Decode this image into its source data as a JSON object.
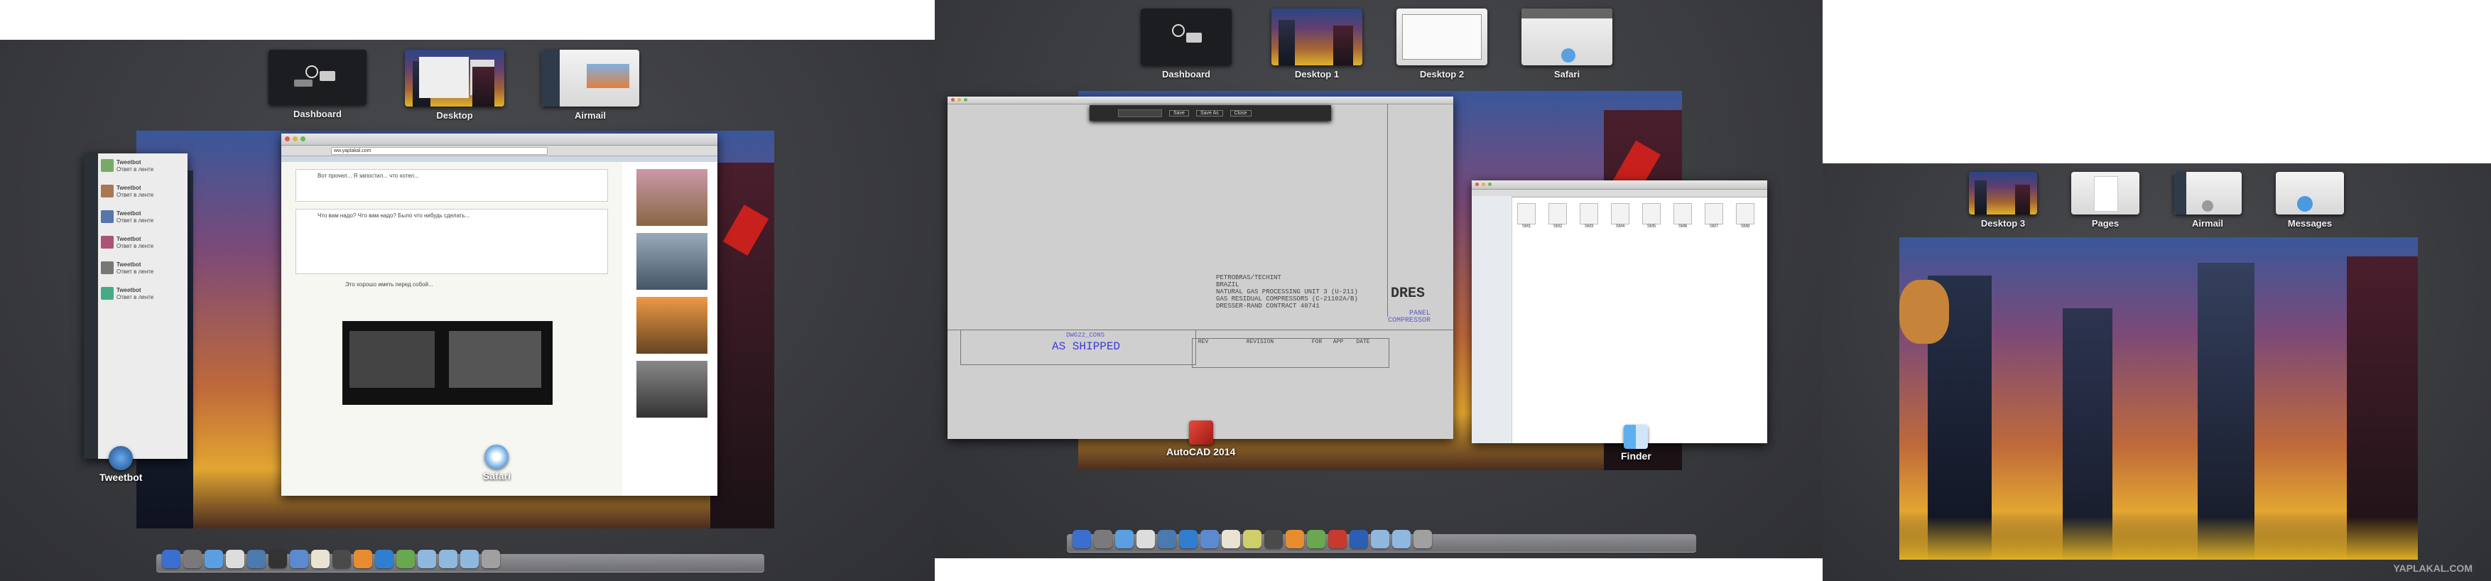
{
  "panels": [
    {
      "spaces": [
        {
          "label": "Dashboard"
        },
        {
          "label": "Desktop"
        },
        {
          "label": "Airmail"
        }
      ],
      "windows": [
        {
          "label": "Tweetbot"
        },
        {
          "label": "Safari"
        }
      ],
      "safari": {
        "url": "ww.yaplakal.com",
        "post_user": "Tweetbot",
        "post_text_1": "Вот прочел... Я запостил... что хотел...",
        "post_text_2": "Что вам надо? Что вам надо? Было что нибудь сделать...",
        "post_text_3": "Это хорошо иметь перед собой..."
      },
      "tweetbot": {
        "items": [
          {
            "name": "Tweetbot",
            "text": "Ответ в ленте"
          },
          {
            "name": "Tweetbot",
            "text": "Ответ в ленте"
          },
          {
            "name": "Tweetbot",
            "text": "Ответ в ленте"
          },
          {
            "name": "Tweetbot",
            "text": "Ответ в ленте"
          },
          {
            "name": "Tweetbot",
            "text": "Ответ в ленте"
          },
          {
            "name": "Tweetbot",
            "text": "Ответ в ленте"
          }
        ]
      }
    },
    {
      "spaces": [
        {
          "label": "Dashboard"
        },
        {
          "label": "Desktop 1"
        },
        {
          "label": "Desktop 2"
        },
        {
          "label": "Safari"
        }
      ],
      "windows": [
        {
          "label": "AutoCAD 2014"
        },
        {
          "label": "Finder"
        }
      ],
      "autocad": {
        "dialog_buttons": [
          "Save",
          "Save As",
          "Close"
        ],
        "as_shipped": "AS SHIPPED",
        "drawing_ref": "DWG22_CONS",
        "note_lines": [
          "PETROBRAS/TECHINT",
          "BRAZIL",
          "NATURAL GAS PROCESSING UNIT 3 (U-211)",
          "GAS RESIDUAL COMPRESSORS (C-21102A/B)",
          "DRESSER-RAND CONTRACT 40741"
        ],
        "title_block": [
          "DRES",
          "PANEL",
          "COMPRESSOR"
        ],
        "revision_header": [
          "REV",
          "REVISION",
          "FOR",
          "APP",
          "DATE"
        ]
      },
      "finder": {
        "files": [
          "SM1",
          "SM2",
          "SM3",
          "SM4",
          "SM5",
          "SM6",
          "SM7",
          "SM8"
        ]
      }
    },
    {
      "spaces": [
        {
          "label": "Desktop 3"
        },
        {
          "label": "Pages"
        },
        {
          "label": "Airmail"
        },
        {
          "label": "Messages"
        }
      ],
      "watermark": "YAPLAKAL.COM"
    }
  ]
}
